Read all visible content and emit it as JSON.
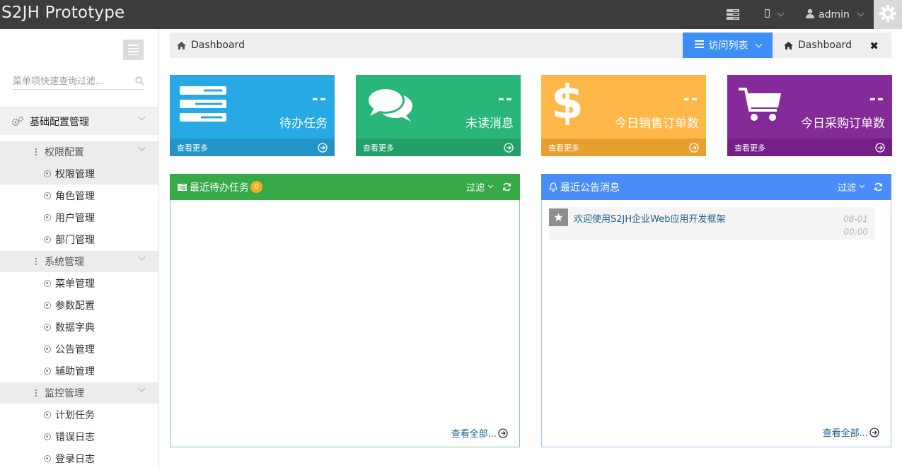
{
  "topbar": {
    "brand": "S2JH Prototype",
    "user_name": "admin"
  },
  "sidebar": {
    "search_placeholder": "菜单项快速查询过滤...",
    "group": "基础配置管理",
    "sections": [
      {
        "title": "权限配置",
        "items": [
          "权限管理",
          "角色管理",
          "用户管理",
          "部门管理"
        ]
      },
      {
        "title": "系统管理",
        "items": [
          "菜单管理",
          "参数配置",
          "数据字典",
          "公告管理",
          "辅助管理"
        ]
      },
      {
        "title": "监控管理",
        "items": [
          "计划任务",
          "错误日志",
          "登录日志"
        ]
      }
    ],
    "active_item": "权限管理"
  },
  "breadcrumb": {
    "label": "Dashboard"
  },
  "tabs": {
    "visit_list": "访问列表",
    "dashboard_tab": "Dashboard"
  },
  "stats": [
    {
      "num": "--",
      "desc": "待办任务",
      "more": "查看更多",
      "color": "#27a9e3",
      "foot_color": "#2394c8"
    },
    {
      "num": "--",
      "desc": "未读消息",
      "more": "查看更多",
      "color": "#28b779",
      "foot_color": "#21a06a"
    },
    {
      "num": "--",
      "desc": "今日销售订单数",
      "more": "查看更多",
      "color": "#ffb848",
      "foot_color": "#e79f2f"
    },
    {
      "num": "--",
      "desc": "今日采购订单数",
      "more": "查看更多",
      "color": "#852b99",
      "foot_color": "#741f87"
    }
  ],
  "panels": {
    "todo": {
      "title": "最近待办任务",
      "badge": "0",
      "filter": "过滤",
      "more": "查看全部...",
      "color": "#35aa47"
    },
    "notice": {
      "title": "最近公告消息",
      "filter": "过滤",
      "more": "查看全部...",
      "color": "#4b8df8",
      "items": [
        {
          "text": "欢迎使用S2JH企业Web应用开发框架",
          "date": "08-01",
          "time": "00:00"
        }
      ]
    }
  }
}
